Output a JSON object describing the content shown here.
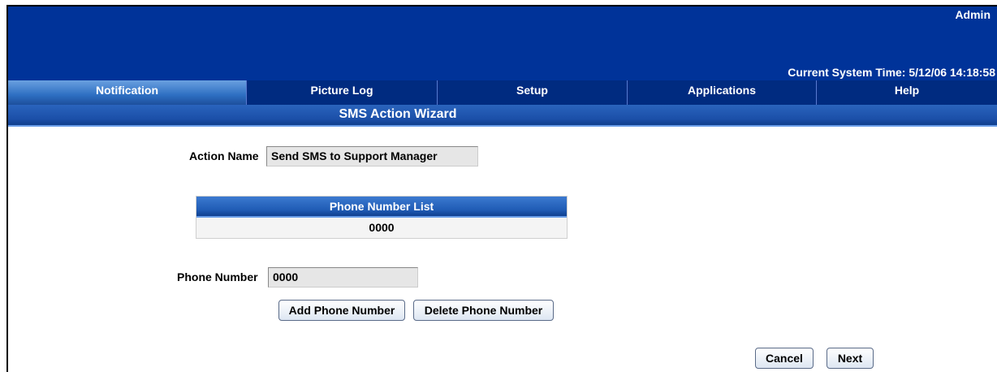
{
  "header": {
    "user": "Admin",
    "system_time_label": "Current System Time: 5/12/06 14:18:58"
  },
  "tabs": [
    {
      "label": "Notification",
      "active": true
    },
    {
      "label": "Picture Log",
      "active": false
    },
    {
      "label": "Setup",
      "active": false
    },
    {
      "label": "Applications",
      "active": false
    },
    {
      "label": "Help",
      "active": false
    }
  ],
  "wizard": {
    "title": "SMS Action Wizard",
    "action_name_label": "Action Name",
    "action_name_value": "Send SMS to Support Manager",
    "phone_list_header": "Phone Number List",
    "phone_list": [
      "0000"
    ],
    "phone_number_label": "Phone Number",
    "phone_number_value": "0000",
    "add_button": "Add Phone Number",
    "delete_button": "Delete Phone Number",
    "cancel_button": "Cancel",
    "next_button": "Next"
  },
  "colors": {
    "banner": "#003399",
    "tab_bg": "#002b80",
    "active_tab": "#2e6fc2"
  }
}
